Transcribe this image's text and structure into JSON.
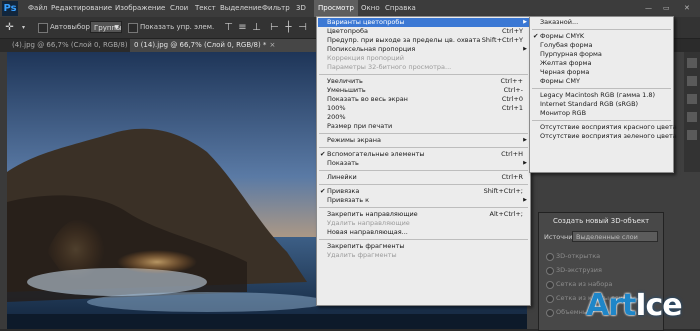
{
  "app": {
    "logo": "Ps",
    "menubar": [
      "Файл",
      "Редактирование",
      "Изображение",
      "Слои",
      "Текст",
      "Выделение",
      "Фильтр",
      "3D",
      "Просмотр",
      "Окно",
      "Справка"
    ],
    "active_menu": "Просмотр"
  },
  "options": {
    "autoselect_label": "Автовыбор:",
    "autoselect_value": "Группы",
    "show_controls_label": "Показать упр. элем."
  },
  "tabs": [
    {
      "label": "(4).jpg @ 66,7% (Слой 0, RGB/8) *",
      "active": false
    },
    {
      "label": "0 (14).jpg @ 66,7% (Слой 0, RGB/8) *",
      "active": true
    }
  ],
  "view_menu": [
    {
      "label": "Варианты цветопробы",
      "submenu": true,
      "highlighted": true
    },
    {
      "label": "Цветопроба",
      "shortcut": "Ctrl+Y"
    },
    {
      "label": "Предупр. при выходе за пределы цв. охвата",
      "shortcut": "Shift+Ctrl+Y"
    },
    {
      "label": "Попиксельная пропорция",
      "submenu": true
    },
    {
      "label": "Коррекция пропорций",
      "disabled": true
    },
    {
      "label": "Параметры 32-битного просмотра...",
      "disabled": true
    },
    {
      "separator": true
    },
    {
      "label": "Увеличить",
      "shortcut": "Ctrl++"
    },
    {
      "label": "Уменьшить",
      "shortcut": "Ctrl+-"
    },
    {
      "label": "Показать во весь экран",
      "shortcut": "Ctrl+0"
    },
    {
      "label": "100%",
      "shortcut": "Ctrl+1"
    },
    {
      "label": "200%"
    },
    {
      "label": "Размер при печати"
    },
    {
      "separator": true
    },
    {
      "label": "Режимы экрана",
      "submenu": true
    },
    {
      "separator": true
    },
    {
      "label": "Вспомогательные элементы",
      "shortcut": "Ctrl+H",
      "checked": true
    },
    {
      "label": "Показать",
      "submenu": true
    },
    {
      "separator": true
    },
    {
      "label": "Линейки",
      "shortcut": "Ctrl+R"
    },
    {
      "separator": true
    },
    {
      "label": "Привязка",
      "shortcut": "Shift+Ctrl+;",
      "checked": true
    },
    {
      "label": "Привязать к",
      "submenu": true
    },
    {
      "separator": true
    },
    {
      "label": "Закрепить направляющие",
      "shortcut": "Alt+Ctrl+;"
    },
    {
      "label": "Удалить направляющие",
      "disabled": true
    },
    {
      "label": "Новая направляющая..."
    },
    {
      "separator": true
    },
    {
      "label": "Закрепить фрагменты"
    },
    {
      "label": "Удалить фрагменты",
      "disabled": true
    }
  ],
  "proof_submenu": [
    {
      "label": "Заказной..."
    },
    {
      "separator": true
    },
    {
      "label": "Формы CMYK",
      "checked": true
    },
    {
      "label": "Голубая форма"
    },
    {
      "label": "Пурпурная форма"
    },
    {
      "label": "Желтая форма"
    },
    {
      "label": "Черная форма"
    },
    {
      "label": "Формы CMY"
    },
    {
      "separator": true
    },
    {
      "label": "Legacy Macintosh RGB (гамма 1.8)"
    },
    {
      "label": "Internet Standard RGB (sRGB)"
    },
    {
      "label": "Монитор RGB"
    },
    {
      "separator": true
    },
    {
      "label": "Отсутствие восприятия красного цвета"
    },
    {
      "label": "Отсутствие восприятия зеленого цвета"
    }
  ],
  "panel_3d": {
    "title": "Создать новый 3D-объект",
    "source_label": "Источник:",
    "source_value": "Выделенные слои",
    "options": [
      "3D-открытка",
      "3D-экструзия",
      "Сетка из набора",
      "Сетка из карты глубины",
      "Объемный"
    ]
  },
  "watermark": {
    "part1": "Art",
    "part2": "Ice"
  },
  "colors": {
    "menu_bg": "#ececec",
    "highlight": "#3b78d4",
    "menubar_bg": "#3c3c3c"
  }
}
